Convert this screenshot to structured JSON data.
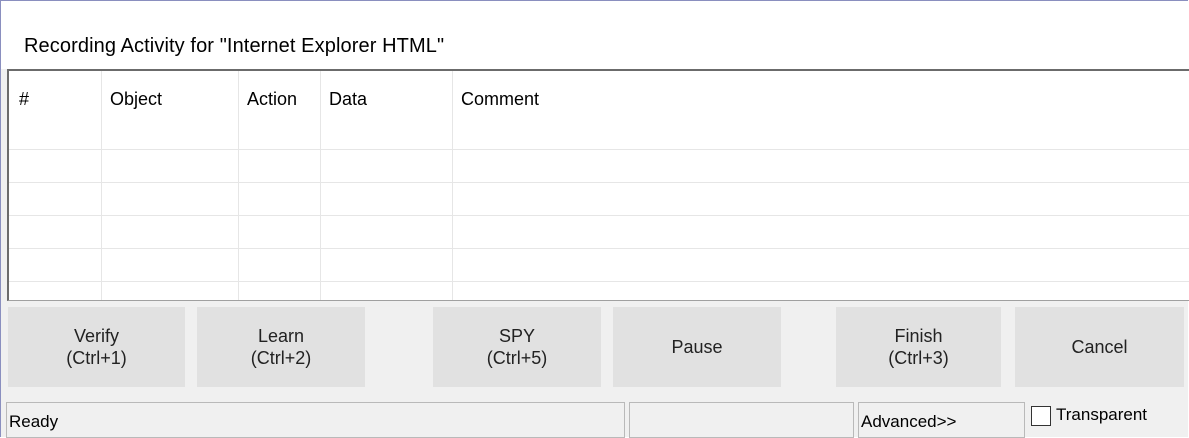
{
  "window": {
    "title": "Recording Activity for \"Internet Explorer HTML\""
  },
  "grid": {
    "columns": [
      "#",
      "Object",
      "Action",
      "Data",
      "Comment"
    ],
    "rows": []
  },
  "buttons": {
    "verify": {
      "line1": "Verify",
      "line2": "(Ctrl+1)"
    },
    "learn": {
      "line1": "Learn",
      "line2": "(Ctrl+2)"
    },
    "spy": {
      "line1": "SPY",
      "line2": "(Ctrl+5)"
    },
    "pause": {
      "label": "Pause"
    },
    "finish": {
      "line1": "Finish",
      "line2": "(Ctrl+3)"
    },
    "cancel": {
      "label": "Cancel"
    }
  },
  "status": {
    "text": "Ready",
    "middle": "",
    "advanced_label": "Advanced>>",
    "transparent_label": "Transparent",
    "transparent_checked": false
  }
}
